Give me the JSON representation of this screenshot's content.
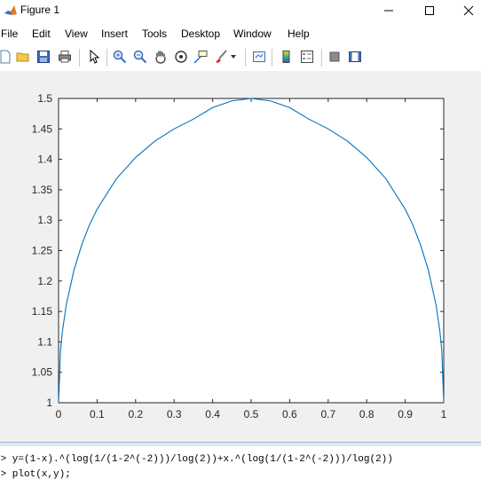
{
  "window": {
    "title": "Figure 1",
    "icon": "matlab-figure-icon",
    "controls": [
      "minimize",
      "maximize",
      "close"
    ]
  },
  "menubar": {
    "items": [
      "File",
      "Edit",
      "View",
      "Insert",
      "Tools",
      "Desktop",
      "Window",
      "Help"
    ]
  },
  "toolbar": {
    "buttons": [
      "new-figure-icon",
      "open-folder-icon",
      "save-icon",
      "print-icon",
      "pointer-icon",
      "zoom-in-icon",
      "zoom-out-icon",
      "pan-hand-icon",
      "rotate-3d-icon",
      "data-cursor-icon",
      "brush-icon",
      "brush-dropdown-icon",
      "link-plot-icon",
      "colorbar-icon",
      "legend-icon",
      "hide-plot-tools-icon",
      "show-plot-tools-icon"
    ]
  },
  "command_window": {
    "lines": [
      ">> y=(1-x).^(log(1/(1-2^(-2)))/log(2))+x.^(log(1/(1-2^(-2)))/log(2))",
      ">> plot(x,y);"
    ]
  },
  "colors": {
    "line": "#0072bd",
    "figure_bg": "#f0f0f0",
    "axes_bg": "#ffffff"
  },
  "chart_data": {
    "type": "line",
    "title": "",
    "xlabel": "",
    "ylabel": "",
    "xlim": [
      0,
      1
    ],
    "ylim": [
      1,
      1.5
    ],
    "xticks": [
      "0",
      "0.1",
      "0.2",
      "0.3",
      "0.4",
      "0.5",
      "0.6",
      "0.7",
      "0.8",
      "0.9",
      "1"
    ],
    "yticks": [
      "1",
      "1.05",
      "1.1",
      "1.15",
      "1.2",
      "1.25",
      "1.3",
      "1.35",
      "1.4",
      "1.45",
      "1.5"
    ],
    "grid": false,
    "series": [
      {
        "color": "#0072bd",
        "x": [
          0,
          0.005,
          0.01,
          0.02,
          0.04,
          0.06,
          0.08,
          0.1,
          0.15,
          0.2,
          0.25,
          0.3,
          0.35,
          0.4,
          0.45,
          0.5,
          0.55,
          0.6,
          0.65,
          0.7,
          0.75,
          0.8,
          0.85,
          0.9,
          0.92,
          0.94,
          0.96,
          0.98,
          0.99,
          0.995,
          1
        ],
        "y": [
          1,
          1.086,
          1.1175,
          1.161,
          1.218,
          1.259,
          1.292,
          1.318,
          1.368,
          1.403,
          1.43,
          1.45,
          1.466,
          1.485,
          1.496,
          1.5,
          1.496,
          1.485,
          1.466,
          1.45,
          1.43,
          1.403,
          1.368,
          1.318,
          1.292,
          1.259,
          1.218,
          1.161,
          1.1175,
          1.086,
          1
        ]
      }
    ]
  }
}
